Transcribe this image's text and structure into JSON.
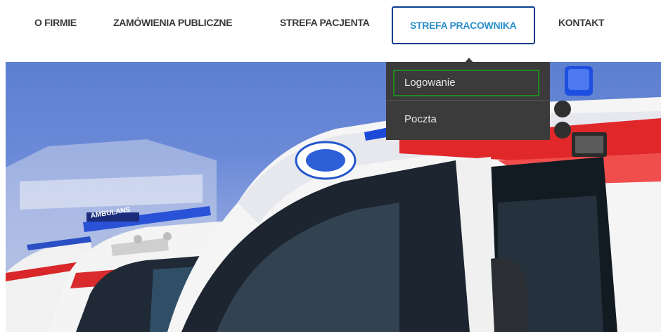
{
  "nav": {
    "items": [
      {
        "label": "O FIRMIE"
      },
      {
        "label": "ZAMÓWIENIA PUBLICZNE"
      },
      {
        "label": "STREFA PACJENTA"
      },
      {
        "label": "STREFA PRACOWNIKA"
      },
      {
        "label": "KONTAKT"
      }
    ],
    "active_index": 3
  },
  "dropdown": {
    "items": [
      {
        "label": "Logowanie"
      },
      {
        "label": "Poczta"
      }
    ],
    "focused_index": 0
  },
  "hero": {
    "vehicle_labels": [
      "AMBULANS"
    ]
  },
  "colors": {
    "nav_text": "#3a3a3a",
    "active_text": "#2b8fcc",
    "active_border": "#0c3f8e",
    "dropdown_bg": "#3b3b3b",
    "focus_border": "#1f8a1f"
  }
}
